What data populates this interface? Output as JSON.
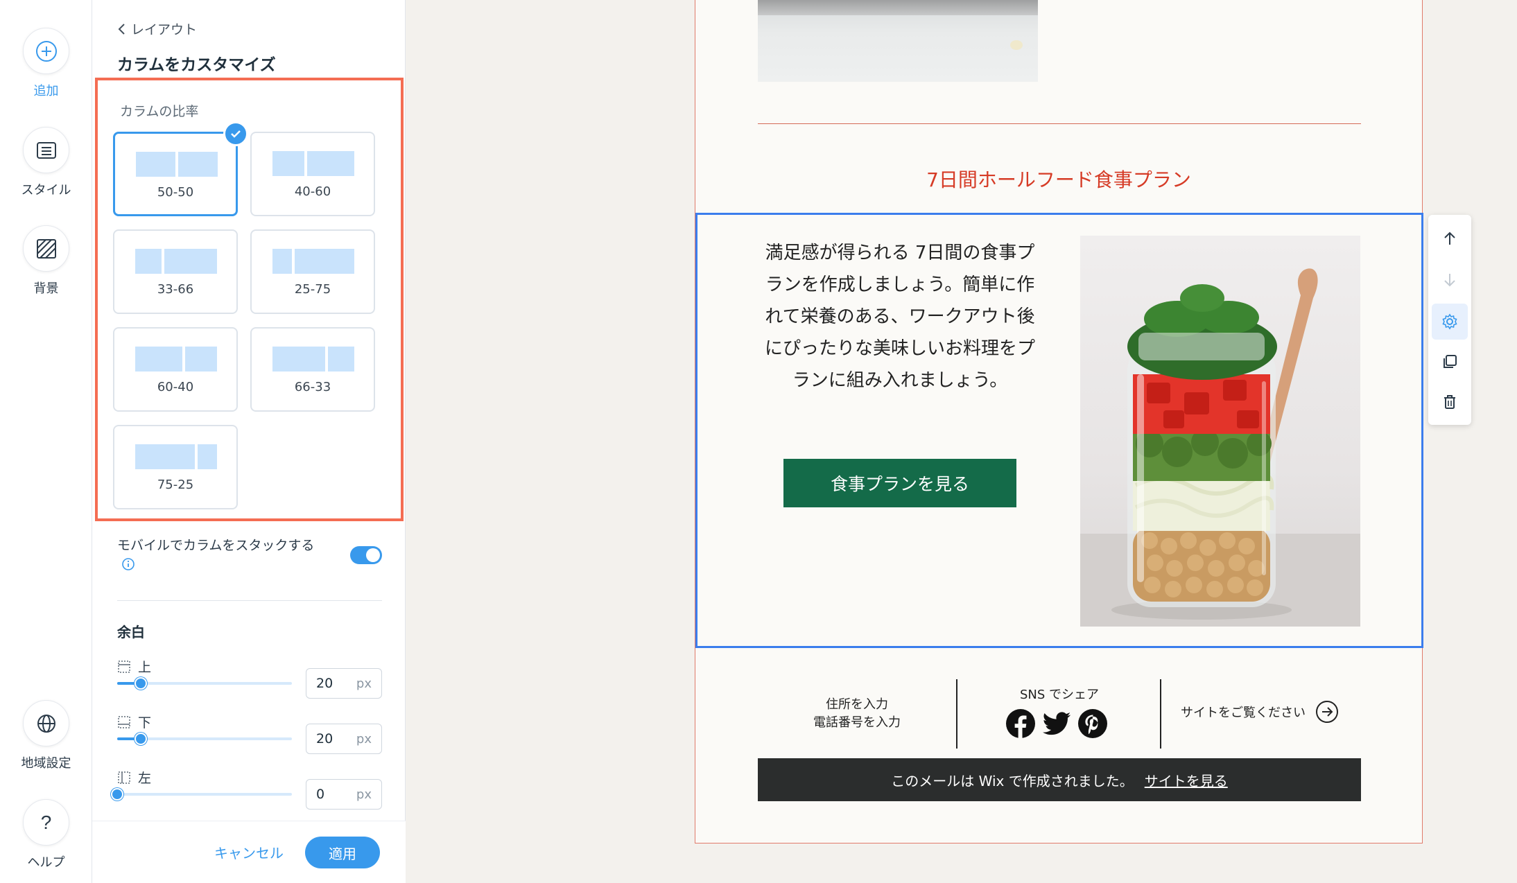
{
  "rail": {
    "add": "追加",
    "style": "スタイル",
    "background": "背景",
    "locale": "地域設定",
    "help": "ヘルプ"
  },
  "panel": {
    "back": "レイアウト",
    "title": "カラムをカスタマイズ",
    "ratio_label": "カラムの比率",
    "ratios": [
      "50-50",
      "40-60",
      "33-66",
      "25-75",
      "60-40",
      "66-33",
      "75-25"
    ],
    "selected_ratio": "50-50",
    "stack_label": "モバイルでカラムをスタックする",
    "stack_enabled": true,
    "padding_title": "余白",
    "padding": {
      "top_label": "上",
      "top_value": "20",
      "bottom_label": "下",
      "bottom_value": "20",
      "left_label": "左",
      "left_value": "0",
      "unit": "px"
    },
    "cancel": "キャンセル",
    "apply": "適用"
  },
  "email": {
    "heading": "7日間ホールフード食事プラン",
    "body": "満足感が得られる 7日間の食事プランを作成しましょう。簡単に作れて栄養のある、ワークアウト後にぴったりな美味しいお料理をプランに組み入れましょう。",
    "cta": "食事プランを見る",
    "address_line1": "住所を入力",
    "address_line2": "電話番号を入力",
    "sns_label": "SNS でシェア",
    "visit_label": "サイトをご覧ください",
    "wix_text": "このメールは Wix で作成されました。",
    "wix_link": "サイトを見る"
  },
  "colors": {
    "accent": "#3899ec",
    "highlight_border": "#f46d53",
    "heading_red": "#d63b26",
    "cta_green": "#146b49"
  }
}
